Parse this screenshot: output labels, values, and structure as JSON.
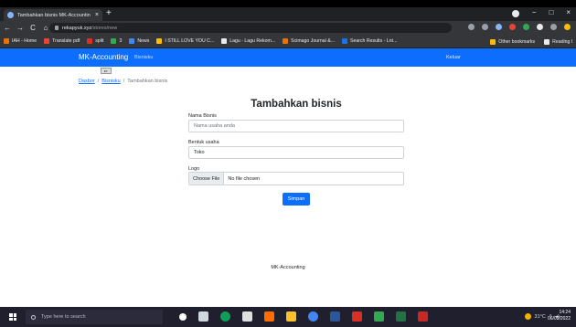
{
  "browser": {
    "tab_title": "Tambahkan bisnis MK-Accountin",
    "tab_close": "×",
    "new_tab": "+",
    "url_host": "rekapyuk.xyz",
    "url_path": "/stores/new",
    "nav": {
      "back": "←",
      "forward": "→",
      "reload": "C",
      "home": "⌂"
    },
    "window_controls": {
      "minimize": "−",
      "maximize": "□",
      "close": "×"
    },
    "bookmarks": [
      {
        "label": "IAH - Home",
        "color": "#e8710a"
      },
      {
        "label": "Translate pdf",
        "color": "#ea4335"
      },
      {
        "label": "split",
        "color": "#d93025"
      },
      {
        "label": "3",
        "color": "#34a853"
      },
      {
        "label": "News",
        "color": "#4285f4"
      },
      {
        "label": "I STILL LOVE YOU C...",
        "color": "#fbbc04"
      },
      {
        "label": "Lagu - Lagu Rekom...",
        "color": "#e8eaed"
      },
      {
        "label": "Scimago Journal &...",
        "color": "#e8710a"
      },
      {
        "label": "Search Results - Lnt...",
        "color": "#1a73e8"
      }
    ],
    "other_bookmarks": "Other bookmarks",
    "reading_list": "Reading l"
  },
  "app": {
    "brand": "MK-Accounting",
    "nav_link": "Bisnisku",
    "logout": "Keluar",
    "accent": "#0d6efd"
  },
  "breadcrumb": {
    "items": [
      "Dasbor",
      "Bisnisku",
      "Tambahkan bisnis"
    ],
    "separator": "/"
  },
  "form": {
    "title": "Tambahkan bisnis",
    "name_label": "Nama Bisnis",
    "name_placeholder": "Nama usaha anda",
    "type_label": "Bentuk usaha",
    "type_value": "Toko",
    "logo_label": "Logo",
    "file_button": "Choose File",
    "file_status": "No file chosen",
    "submit_label": "Simpan"
  },
  "footer": {
    "text": "MK-Accounting"
  },
  "taskbar": {
    "search_placeholder": "Type here to search",
    "weather": "31°C",
    "time": "14:24",
    "date": "06/02/2022"
  }
}
